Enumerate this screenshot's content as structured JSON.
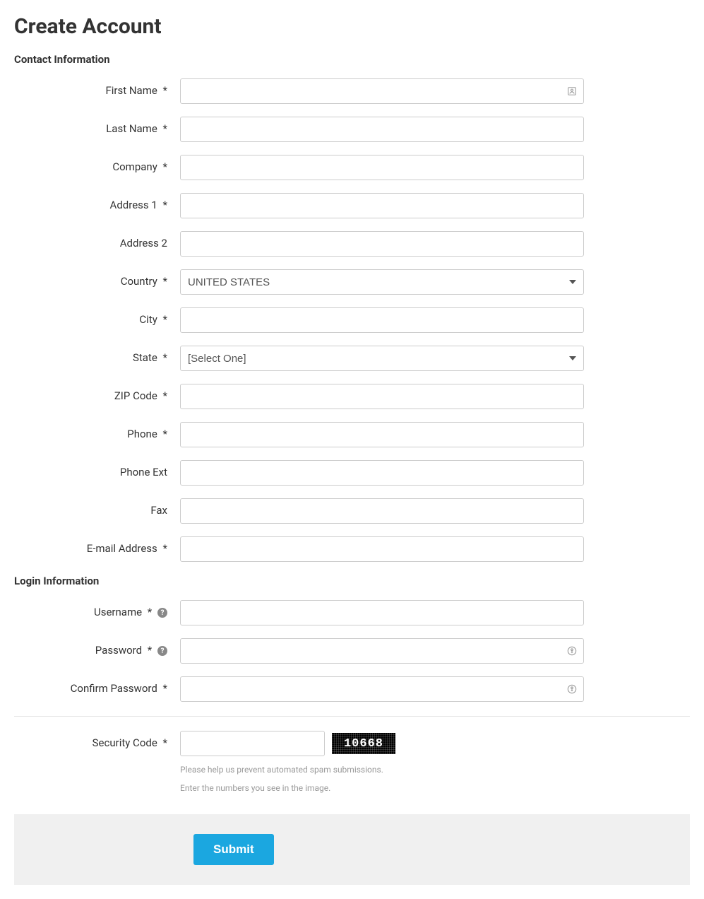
{
  "page": {
    "title": "Create Account"
  },
  "sections": {
    "contact": "Contact Information",
    "login": "Login Information"
  },
  "labels": {
    "first_name": "First Name",
    "last_name": "Last Name",
    "company": "Company",
    "address1": "Address 1",
    "address2": "Address 2",
    "country": "Country",
    "city": "City",
    "state": "State",
    "zip": "ZIP Code",
    "phone": "Phone",
    "phone_ext": "Phone Ext",
    "fax": "Fax",
    "email": "E-mail Address",
    "username": "Username",
    "password": "Password",
    "confirm_password": "Confirm Password",
    "security_code": "Security Code"
  },
  "required_mark": "*",
  "values": {
    "first_name": "",
    "last_name": "",
    "company": "",
    "address1": "",
    "address2": "",
    "country": "UNITED STATES",
    "city": "",
    "state": "[Select One]",
    "zip": "",
    "phone": "",
    "phone_ext": "",
    "fax": "",
    "email": "",
    "username": "",
    "password": "",
    "confirm_password": "",
    "security_code": ""
  },
  "options": {
    "country": [
      "UNITED STATES"
    ],
    "state": [
      "[Select One]"
    ]
  },
  "captcha": {
    "image_text": "10668",
    "help1": "Please help us prevent automated spam submissions.",
    "help2": "Enter the numbers you see in the image."
  },
  "buttons": {
    "submit": "Submit"
  }
}
